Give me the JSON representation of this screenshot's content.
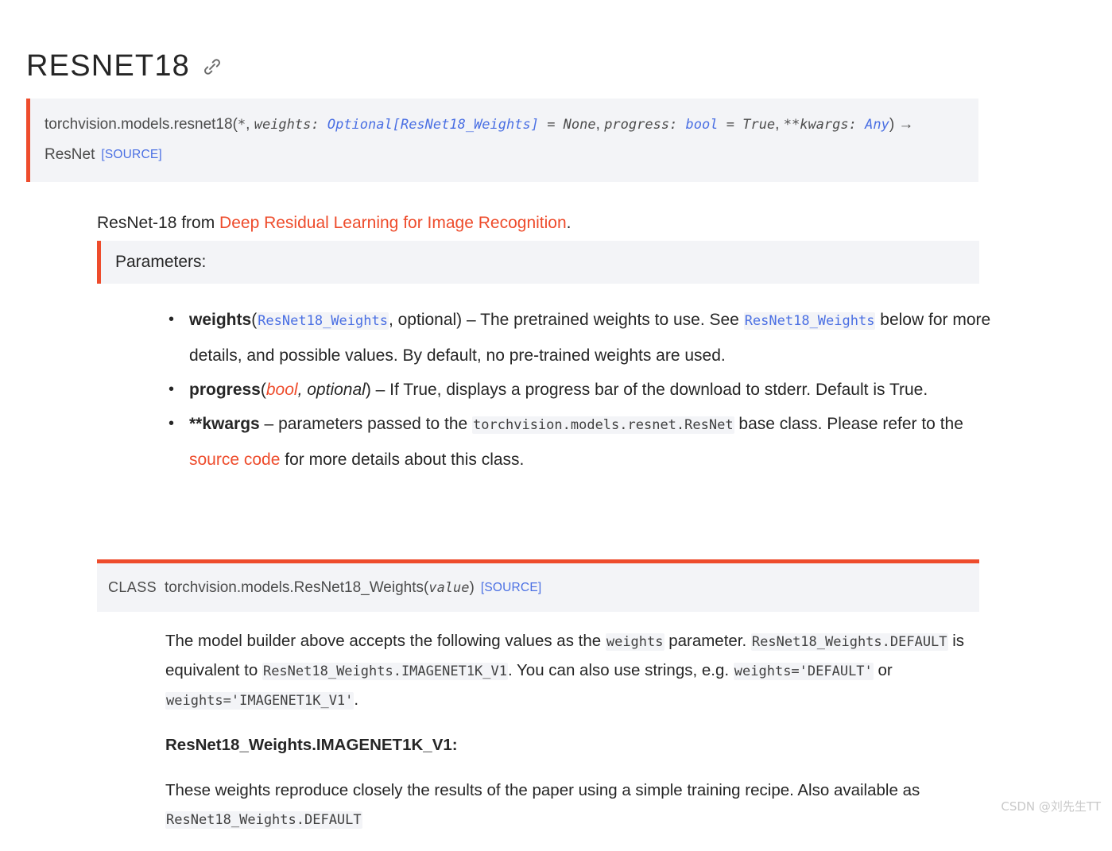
{
  "page": {
    "title": "RESNET18",
    "headerlink_icon": "link-chain-icon"
  },
  "signature": {
    "prefix": "torchvision.models.",
    "func_name": "resnet18",
    "open_paren": "(",
    "star": "*",
    "comma1": ", ",
    "param1_name": "weights: ",
    "param1_type": "Optional[ResNet18_Weights]",
    "eq1": " = ",
    "param1_default": "None",
    "comma2": ", ",
    "param2_name": "progress: ",
    "param2_type": "bool",
    "eq2": " = ",
    "param2_default": "True",
    "comma3": ", ",
    "param3_name": "**kwargs: ",
    "param3_type": "Any",
    "close_paren": ")",
    "arrow": "→",
    "return_type": "ResNet",
    "source_label": "[SOURCE]"
  },
  "description": {
    "before_link": "ResNet-18 from ",
    "link_text": "Deep Residual Learning for Image Recognition",
    "after_link": "."
  },
  "parameters_header": "Parameters:",
  "parameters": [
    {
      "name": "weights",
      "type_code": "ResNet18_Weights",
      "type_suffix": ", optional)",
      "type_prefix": "(",
      "desc_part1": " – The pretrained weights to use. See ",
      "desc_code": "ResNet18_Weights",
      "desc_part2": " below for more details, and possible values. By default, no pre-trained weights are used."
    },
    {
      "name": "progress",
      "type_prefix": "(",
      "type_italic_red": "bool",
      "type_italic_plain": ", optional",
      "type_suffix": ")",
      "desc_part1": " – If True, displays a progress bar of the download to stderr. Default is True."
    },
    {
      "name": "**kwargs",
      "desc_part1": " – parameters passed to the ",
      "desc_code": "torchvision.models.resnet.ResNet",
      "desc_part2": " base class. Please refer to the ",
      "desc_link": "source code",
      "desc_part3": " for more details about this class."
    }
  ],
  "class_block": {
    "keyword": "CLASS",
    "qualified_name": "torchvision.models.ResNet18_Weights",
    "open_paren": "(",
    "arg": "value",
    "close_paren": ")",
    "source_label": "[SOURCE]"
  },
  "class_body": {
    "para1_part1": "The model builder above accepts the following values as the ",
    "para1_code1": "weights",
    "para1_part2": " parameter. ",
    "para1_code2": "ResNet18_Weights.DEFAULT",
    "para1_part3": " is equivalent to ",
    "para1_code3": "ResNet18_Weights.IMAGENET1K_V1",
    "para1_part4": ". You can also use strings, e.g. ",
    "para1_code4": "weights='DEFAULT'",
    "para1_part5": " or ",
    "para1_code5": "weights='IMAGENET1K_V1'",
    "para1_part6": ".",
    "heading": "ResNet18_Weights.IMAGENET1K_V1:",
    "para2_part1": "These weights reproduce closely the results of the paper using a simple training recipe. Also available as ",
    "para2_code1": "ResNet18_Weights.DEFAULT"
  },
  "watermark": "CSDN @刘先生TT",
  "colors": {
    "brand_accent": "#ee4c2c",
    "code_blue": "#4a6fe3",
    "block_bg": "#f3f4f7",
    "text": "#262626",
    "muted_text": "#4c4c4c",
    "watermark": "#c9c9c9"
  }
}
